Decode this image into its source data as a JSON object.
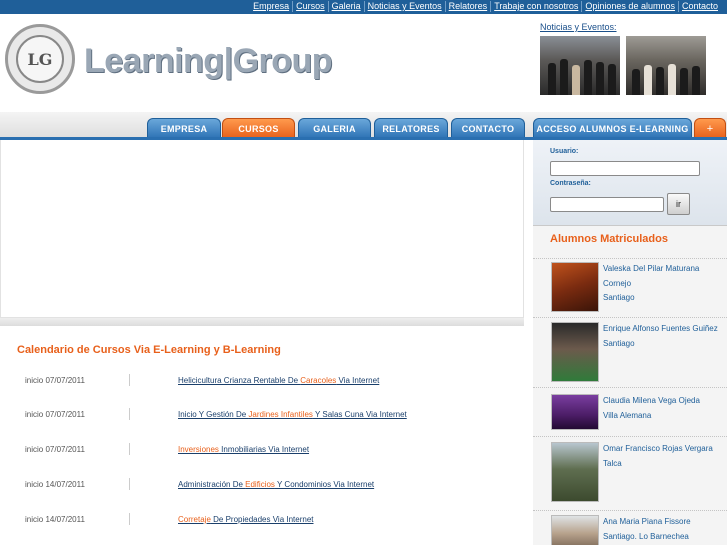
{
  "top_nav": [
    "Empresa",
    "Cursos",
    "Galeria",
    "Noticias y Eventos",
    "Relatores",
    "Trabaje con nosotros",
    "Opiniones de alumnos",
    "Contacto"
  ],
  "header": {
    "logo_text": "Learning|Group",
    "logo_monogram": "LG",
    "news_label": "Noticias y Eventos:"
  },
  "main_tabs": [
    {
      "label": "EMPRESA",
      "active": false
    },
    {
      "label": "CURSOS",
      "active": true
    },
    {
      "label": "GALERIA",
      "active": false
    },
    {
      "label": "RELATORES",
      "active": false
    },
    {
      "label": "CONTACTO",
      "active": false
    },
    {
      "label": "ACCESO ALUMNOS E-LEARNING",
      "active": false
    }
  ],
  "tab_plus_symbol": "+",
  "login": {
    "user_label": "Usuario:",
    "password_label": "Contraseña:",
    "submit_label": "ir"
  },
  "calendar": {
    "title": "Calendario de Cursos Via E-Learning y B-Learning",
    "courses": [
      {
        "date": "inicio 07/07/2011",
        "pre": "Helicicultura Crianza Rentable De ",
        "hl": "Caracoles",
        "post": " Via Internet"
      },
      {
        "date": "inicio 07/07/2011",
        "pre": "Inicio Y Gestión De ",
        "hl": "Jardines Infantiles",
        "post": " Y Salas Cuna Via Internet"
      },
      {
        "date": "inicio 07/07/2011",
        "pre": "",
        "hl": "Inversiones",
        "post": " Inmobiliarias Via Internet"
      },
      {
        "date": "inicio 14/07/2011",
        "pre": "Administración De ",
        "hl": "Edificios",
        "post": " Y Condominios Via Internet"
      },
      {
        "date": "inicio 14/07/2011",
        "pre": "",
        "hl": "Corretaje",
        "post": " De Propiedades Via Internet"
      }
    ]
  },
  "enrolled": {
    "title": "Alumnos Matriculados",
    "students": [
      {
        "name": "Valeska Del Pilar Maturana Cornejo",
        "city": "Santiago"
      },
      {
        "name": "Enrique Alfonso Fuentes Guiñez",
        "city": "Santiago"
      },
      {
        "name": "Claudia Milena Vega Ojeda",
        "city": "Villa Alemana"
      },
      {
        "name": "Omar Francisco Rojas Vergara",
        "city": "Talca"
      },
      {
        "name": "Ana Maria Piana Fissore",
        "city": "Santiago. Lo Barnechea"
      }
    ]
  },
  "colors": {
    "accent_orange": "#e8601b",
    "nav_blue": "#1f5f99",
    "link_blue": "#1a3f6b"
  }
}
